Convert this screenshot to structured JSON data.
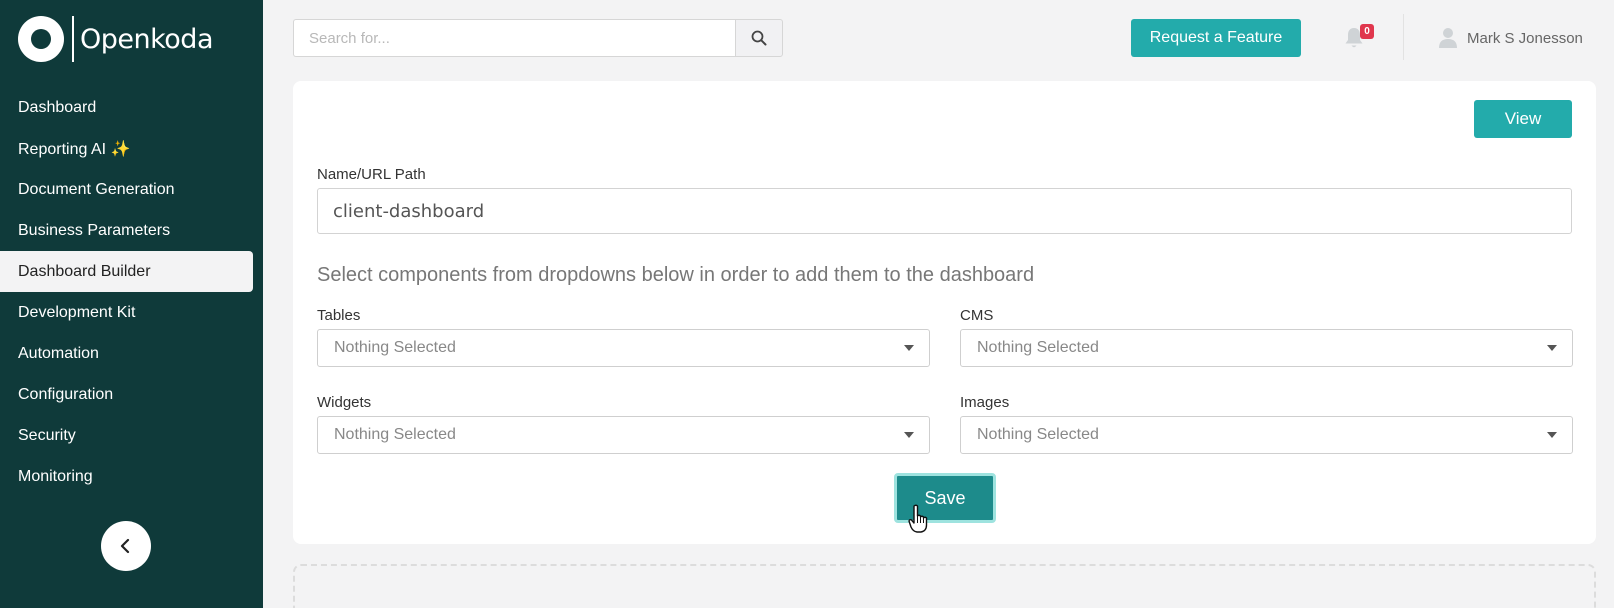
{
  "brand": {
    "name": "Openkoda"
  },
  "sidebar": {
    "items": [
      {
        "label": "Dashboard"
      },
      {
        "label": "Reporting AI ✨"
      },
      {
        "label": "Document Generation"
      },
      {
        "label": "Business Parameters"
      },
      {
        "label": "Dashboard Builder",
        "active": true
      },
      {
        "label": "Development Kit"
      },
      {
        "label": "Automation"
      },
      {
        "label": "Configuration"
      },
      {
        "label": "Security"
      },
      {
        "label": "Monitoring"
      }
    ],
    "collapse_icon": "chevron-left-icon"
  },
  "header": {
    "search": {
      "placeholder": "Search for...",
      "value": "",
      "icon": "search-icon"
    },
    "request_feature_label": "Request a Feature",
    "notifications": {
      "icon": "bell-icon",
      "count": "0"
    },
    "user": {
      "name": "Mark S Jonesson",
      "icon": "user-icon"
    }
  },
  "form": {
    "view_label": "View",
    "name_label": "Name/URL Path",
    "name_value": "client-dashboard",
    "hint": "Select components from dropdowns below in order to add them to the dashboard",
    "selects": {
      "tables": {
        "label": "Tables",
        "value": "Nothing Selected"
      },
      "cms": {
        "label": "CMS",
        "value": "Nothing Selected"
      },
      "widgets": {
        "label": "Widgets",
        "value": "Nothing Selected"
      },
      "images": {
        "label": "Images",
        "value": "Nothing Selected"
      }
    },
    "save_label": "Save"
  },
  "colors": {
    "sidebar_bg": "#0f3a3a",
    "accent": "#23abab",
    "save_bg": "#1d8b8b",
    "badge": "#e0364d"
  }
}
